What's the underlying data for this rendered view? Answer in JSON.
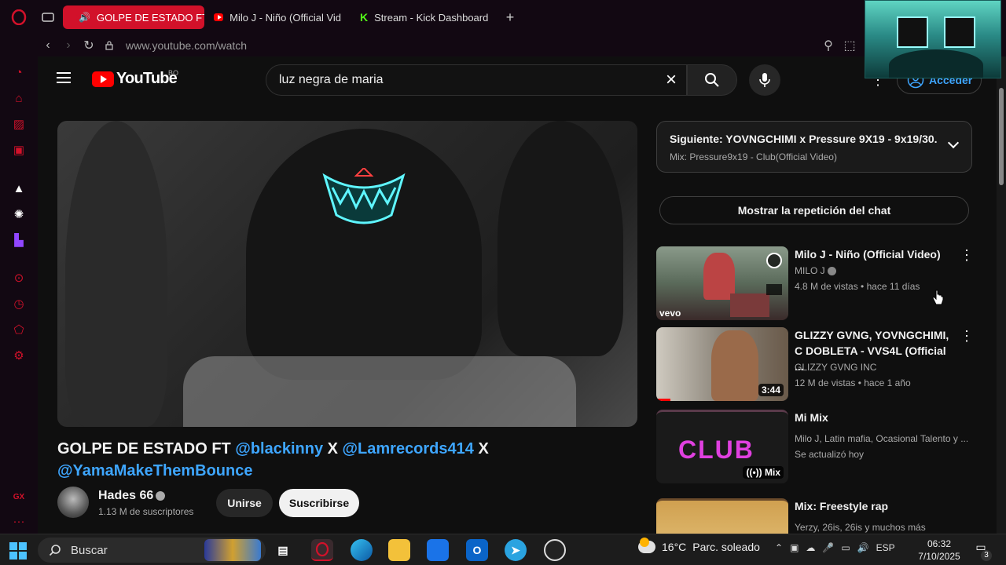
{
  "browser": {
    "tabs": [
      {
        "label": "GOLPE DE ESTADO FT",
        "active": true
      },
      {
        "label": "Milo J - Niño (Official Vid",
        "active": false
      },
      {
        "label": "Stream - Kick Dashboard",
        "active": false
      }
    ],
    "url": "www.youtube.com/watch"
  },
  "youtube": {
    "logo_text": "YouTube",
    "country_code": "BO",
    "search_value": "luz negra de maria",
    "signin_label": "Acceder",
    "video": {
      "title_prefix": "GOLPE DE ESTADO FT ",
      "mention1": "@blackinny",
      "sep1": " X ",
      "mention2": "@Lamrecords414",
      "sep2": " X ",
      "mention3": "@YamaMakeThemBounce",
      "channel": "Hades 66",
      "subscribers": "1.13 M de suscriptores",
      "join_label": "Unirse",
      "subscribe_label": "Suscribirse"
    },
    "up_next": {
      "title": "Siguiente: YOVNGCHIMI x Pressure 9X19 - 9x19/30...",
      "subtitle": "Mix: Pressure9x19 - Club(Official Video)"
    },
    "chat_replay_label": "Mostrar la repetición del chat",
    "recommendations": [
      {
        "title": "Milo J - Niño (Official Video)",
        "channel": "MILO J",
        "meta": "4.8 M de vistas • hace 11 días",
        "badge": "vevo"
      },
      {
        "title": "GLIZZY GVNG, YOVNGCHIMI, C DOBLETA - VVS4L (Official ...",
        "channel": "GLIZZY GVNG INC",
        "meta": "12 M de vistas • hace 1 año",
        "duration": "3:44"
      },
      {
        "title": "Mi Mix",
        "channel": "Milo J, Latin mafia, Ocasional Talento y ...",
        "meta": "Se actualizó hoy",
        "mix_label": "Mix",
        "thumb_text": "CLUB"
      },
      {
        "title": "Mix: Freestyle rap",
        "channel": "Yerzy, 26is, 26is y muchos más",
        "meta": ""
      }
    ]
  },
  "taskbar": {
    "search_placeholder": "Buscar",
    "weather": "16°C",
    "weather_desc": "Parc. soleado",
    "lang": "ESP",
    "time": "06:32",
    "date": "7/10/2025",
    "notif_count": "3"
  },
  "sidebar_labels": {
    "gx": "GX"
  },
  "colors": {
    "opera_red": "#d2112a",
    "yt_link": "#3ea6ff",
    "kick_green": "#53fc18"
  }
}
